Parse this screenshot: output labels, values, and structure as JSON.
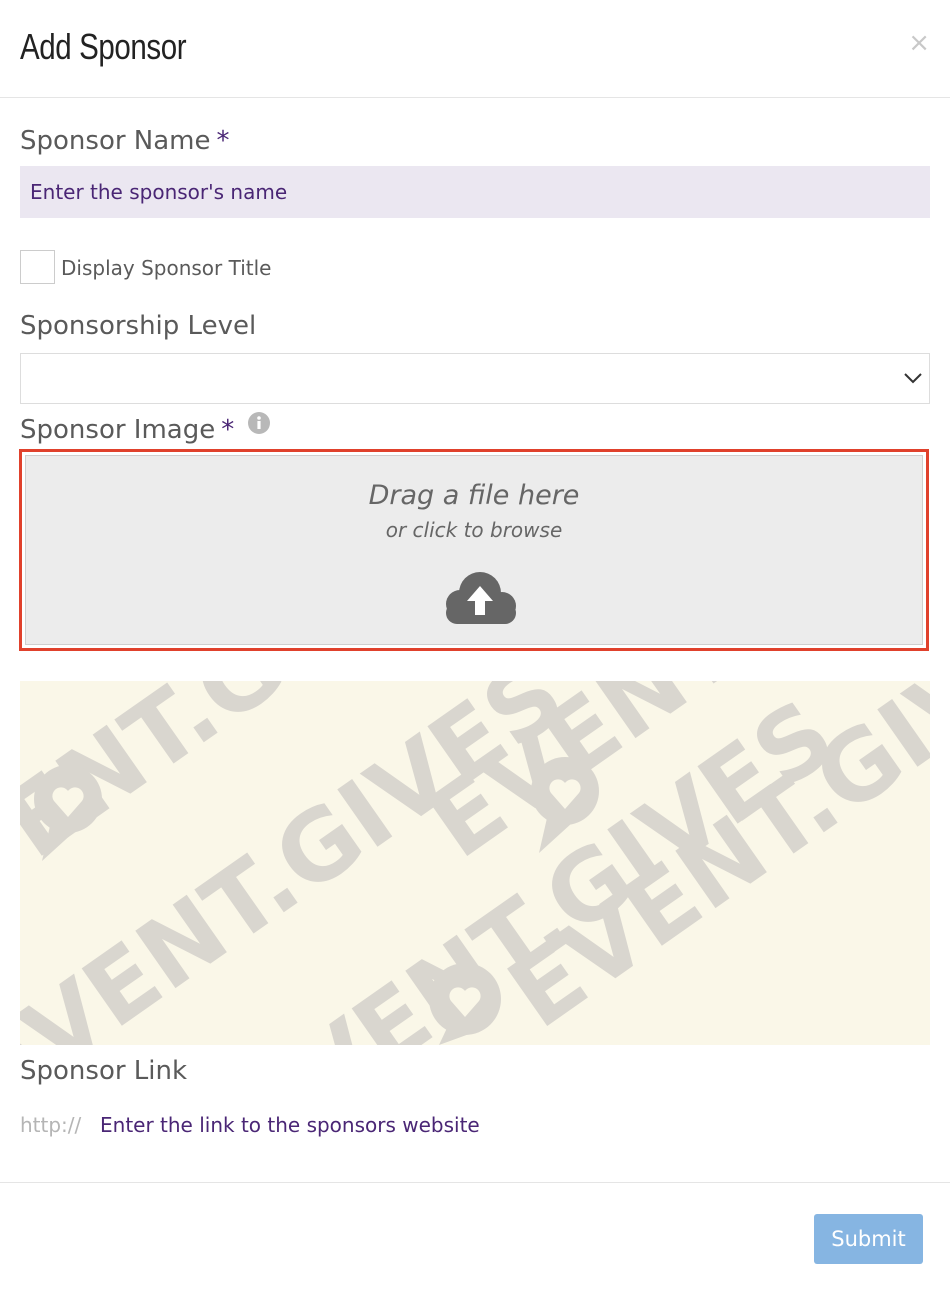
{
  "modal": {
    "title": "Add Sponsor",
    "close_symbol": "×"
  },
  "form": {
    "name": {
      "label": "Sponsor Name",
      "required_marker": "*",
      "placeholder": "Enter the sponsor's name"
    },
    "display_title": {
      "label": "Display Sponsor Title",
      "checked": false
    },
    "level": {
      "label": "Sponsorship Level",
      "selected": ""
    },
    "image": {
      "label": "Sponsor Image",
      "required_marker": "*",
      "info_icon": "info-circle-icon",
      "dropzone_title": "Drag a file here",
      "dropzone_subtitle": "or click to browse",
      "upload_icon": "cloud-upload-icon",
      "preview_watermark": "EVENT.GIVES"
    },
    "link": {
      "label": "Sponsor Link",
      "prefix": "http://",
      "placeholder": "Enter the link to the sponsors website"
    }
  },
  "footer": {
    "submit_label": "Submit"
  },
  "colors": {
    "accent": "#4a2675",
    "required": "#4a2675",
    "input_bg": "#ebe7f1",
    "dropzone_highlight": "#e0412c",
    "submit_bg": "#86b5e2",
    "preview_bg": "#faf7e8"
  }
}
